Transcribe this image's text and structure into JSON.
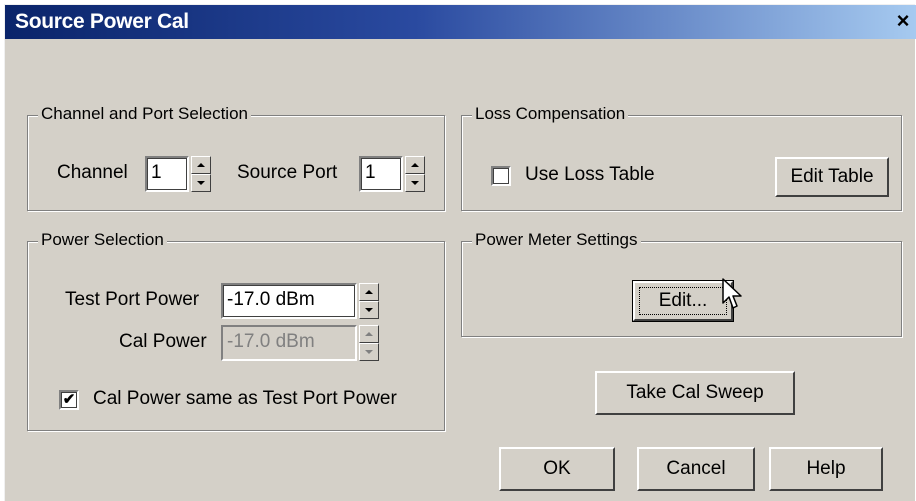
{
  "window": {
    "title": "Source Power Cal",
    "close_glyph": "×"
  },
  "channel_port": {
    "legend": "Channel and Port Selection",
    "channel_label": "Channel",
    "channel_value": "1",
    "source_port_label": "Source Port",
    "source_port_value": "1"
  },
  "loss_compensation": {
    "legend": "Loss Compensation",
    "use_loss_table_label": "Use Loss Table",
    "use_loss_table_checked": false,
    "edit_table_label": "Edit Table"
  },
  "power_selection": {
    "legend": "Power Selection",
    "test_port_power_label": "Test Port Power",
    "test_port_power_value": "-17.0 dBm",
    "cal_power_label": "Cal Power",
    "cal_power_value": "-17.0 dBm",
    "cal_same_label": "Cal Power same as Test Port Power",
    "cal_same_checked": true,
    "check_glyph": "✔"
  },
  "power_meter": {
    "legend": "Power Meter Settings",
    "edit_label": "Edit..."
  },
  "buttons": {
    "take_cal_sweep": "Take Cal Sweep",
    "ok": "OK",
    "cancel": "Cancel",
    "help": "Help"
  },
  "colors": {
    "dialog_face": "#d4d0c8",
    "title_start": "#0a246a",
    "title_end": "#a6caf0",
    "disabled_text": "#808080"
  },
  "icons": {
    "close": "close-icon",
    "spin_up": "chevron-up-icon",
    "spin_down": "chevron-down-icon",
    "checkmark": "checkmark-icon",
    "cursor": "mouse-pointer-icon"
  }
}
